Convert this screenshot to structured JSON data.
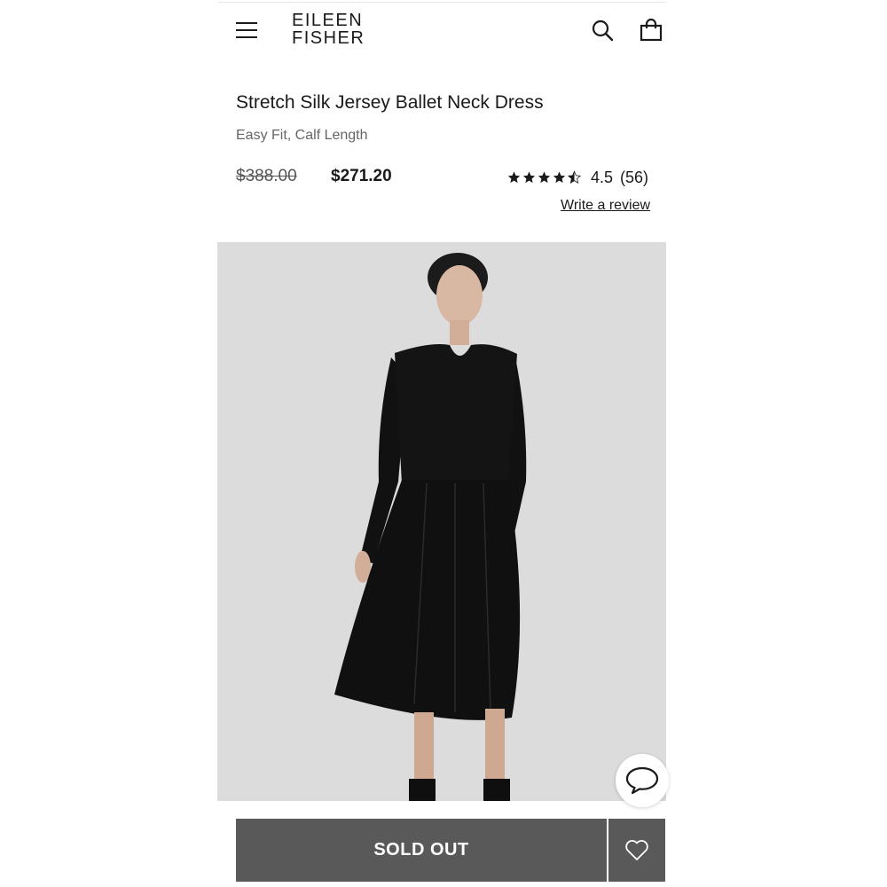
{
  "header": {
    "logo_line1": "EILEEN",
    "logo_line2": "FISHER"
  },
  "product": {
    "title": "Stretch Silk Jersey Ballet Neck Dress",
    "subtitle": "Easy Fit, Calf Length",
    "price_original": "$388.00",
    "price_sale": "$271.20",
    "rating_value": "4.5",
    "rating_count": "(56)",
    "write_review_label": "Write a review"
  },
  "actions": {
    "sold_out_label": "SOLD OUT"
  },
  "icons": {
    "menu": "menu-icon",
    "search": "search-icon",
    "bag": "bag-icon",
    "star": "star-icon",
    "chat": "chat-icon",
    "heart": "heart-icon"
  },
  "colors": {
    "button_bg": "#595959",
    "photo_bg": "#dcdcdc",
    "text": "#1a1a1a"
  }
}
